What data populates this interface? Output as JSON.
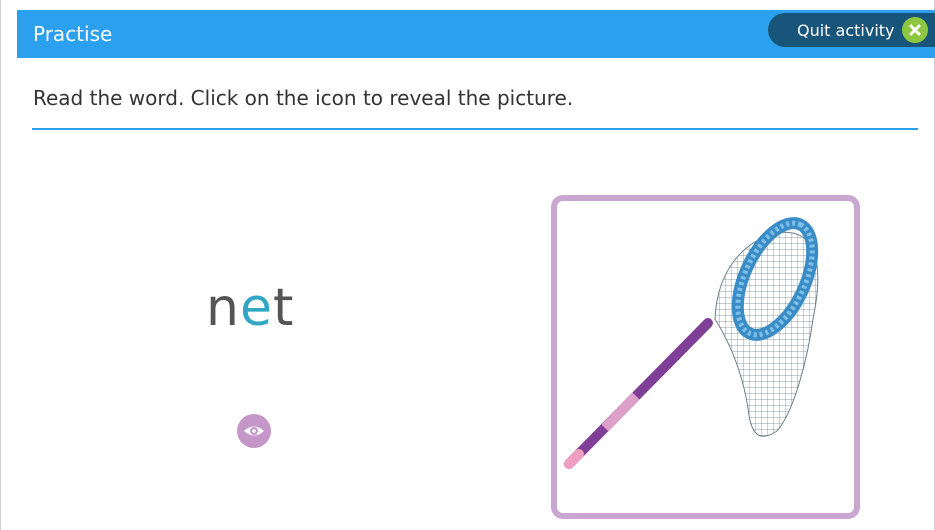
{
  "header": {
    "title": "Practise",
    "quit_label": "Quit activity",
    "accent": "#2aa0ee",
    "quit_bg": "#18557a",
    "quit_icon_color": "#8dc63f"
  },
  "instruction": "Read the word. Click on the icon to reveal the picture.",
  "word": {
    "full": "net",
    "onset": "n",
    "vowel": "e",
    "coda": "t",
    "vowel_color": "#32a7c4"
  },
  "reveal_icon": {
    "name": "eye-icon",
    "color": "#c597c9"
  },
  "picture": {
    "subject": "net",
    "border_color": "#c9a7d1"
  }
}
